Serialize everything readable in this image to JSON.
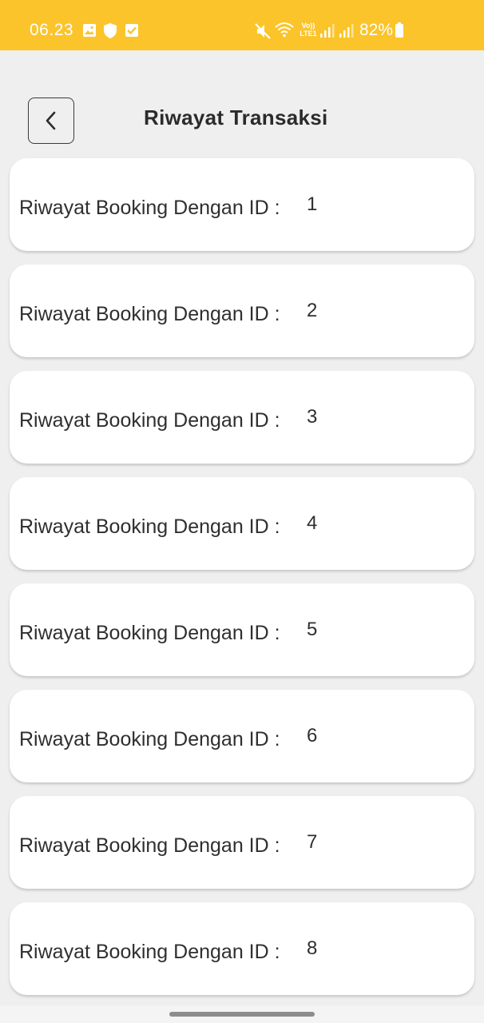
{
  "status_bar": {
    "time": "06.23",
    "battery": "82%",
    "network_label": "LTE1",
    "icons": [
      "gallery-icon",
      "shield-icon",
      "checkbox-icon",
      "mute-icon",
      "wifi-icon",
      "volte-icon",
      "signal-icon",
      "signal-icon",
      "battery-icon"
    ]
  },
  "header": {
    "back_icon": "chevron-left-icon",
    "title": "Riwayat Transaksi"
  },
  "bookings": [
    {
      "label": "Riwayat Booking Dengan ID :",
      "id": "1"
    },
    {
      "label": "Riwayat Booking Dengan ID :",
      "id": "2"
    },
    {
      "label": "Riwayat Booking Dengan ID :",
      "id": "3"
    },
    {
      "label": "Riwayat Booking Dengan ID :",
      "id": "4"
    },
    {
      "label": "Riwayat Booking Dengan ID :",
      "id": "5"
    },
    {
      "label": "Riwayat Booking Dengan ID :",
      "id": "6"
    },
    {
      "label": "Riwayat Booking Dengan ID :",
      "id": "7"
    },
    {
      "label": "Riwayat Booking Dengan ID :",
      "id": "8"
    }
  ],
  "colors": {
    "status_bar": "#fbc42b",
    "background": "#efefef",
    "card": "#ffffff",
    "text": "#2f2f2f"
  }
}
